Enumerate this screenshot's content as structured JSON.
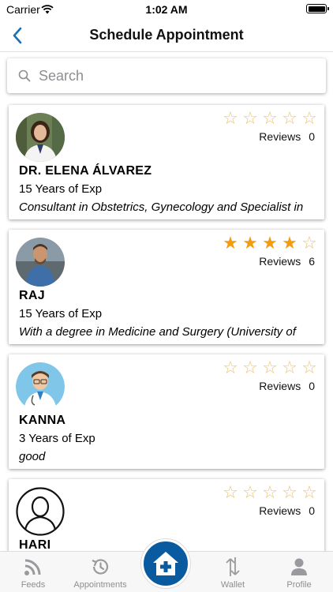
{
  "status_bar": {
    "carrier": "Carrier",
    "time": "1:02 AM"
  },
  "nav": {
    "title": "Schedule Appointment"
  },
  "search": {
    "placeholder": "Search"
  },
  "colors": {
    "accent": "#0a5aa0",
    "star_filled": "#f39c12",
    "star_empty": "#f0c070"
  },
  "doctors": [
    {
      "name": "DR. ELENA ÁLVAREZ",
      "experience": "15 Years of Exp",
      "description": "Consultant in Obstetrics, Gynecology and Specialist in",
      "reviews_label": "Reviews",
      "reviews_count": "0",
      "rating": 0
    },
    {
      "name": "RAJ",
      "experience": "15 Years of Exp",
      "description": "With a degree in Medicine and Surgery (University of",
      "reviews_label": "Reviews",
      "reviews_count": "6",
      "rating": 4
    },
    {
      "name": "KANNA",
      "experience": "3 Years of Exp",
      "description": "good",
      "reviews_label": "Reviews",
      "reviews_count": "0",
      "rating": 0
    },
    {
      "name": "HARI",
      "experience": "",
      "description": "",
      "reviews_label": "Reviews",
      "reviews_count": "0",
      "rating": 0
    }
  ],
  "tabs": {
    "feeds": {
      "label": "Feeds",
      "icon": "rss-icon"
    },
    "appointments": {
      "label": "Appointments",
      "icon": "history-icon"
    },
    "center": {
      "icon": "medical-home-icon"
    },
    "wallet": {
      "label": "Wallet",
      "icon": "transfer-arrows-icon"
    },
    "profile": {
      "label": "Profile",
      "icon": "person-icon"
    }
  }
}
